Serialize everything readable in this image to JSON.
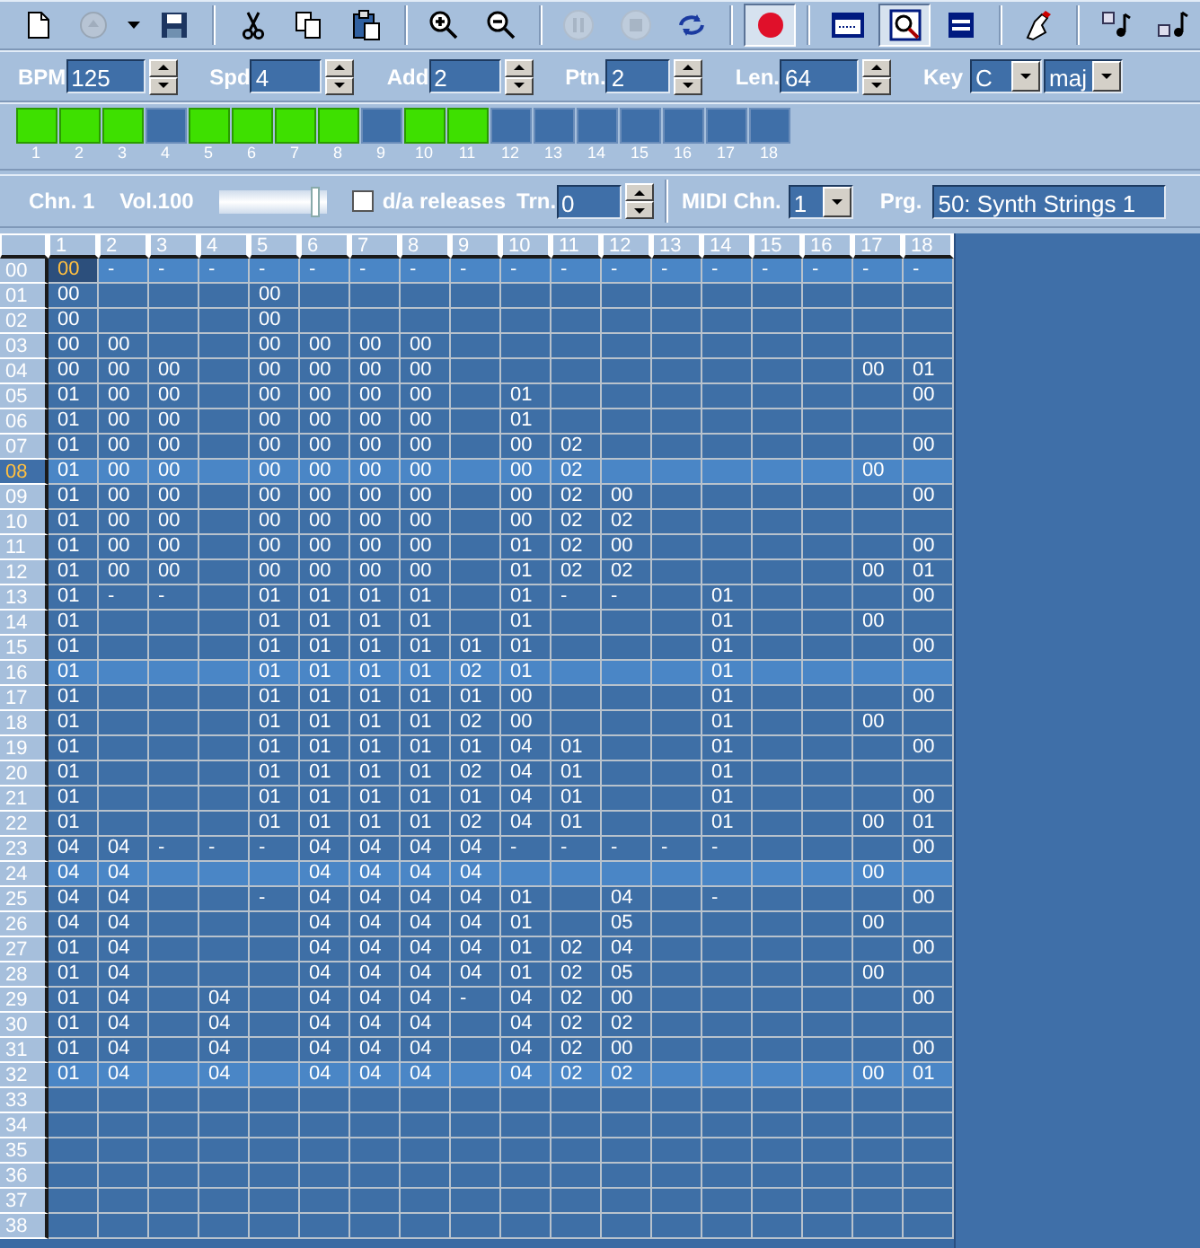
{
  "toolbar": [
    {
      "disabled": false,
      "pressed": false
    },
    {
      "disabled": true,
      "pressed": false
    },
    {
      "disabled": false,
      "pressed": false
    },
    {
      "disabled": false,
      "pressed": false
    },
    {
      "disabled": false,
      "pressed": false
    },
    {
      "disabled": false,
      "pressed": false
    },
    {
      "disabled": false,
      "pressed": false
    },
    {
      "disabled": false,
      "pressed": false
    },
    {
      "disabled": false,
      "pressed": false
    },
    {
      "disabled": true,
      "pressed": false
    },
    {
      "disabled": true,
      "pressed": false
    },
    {
      "disabled": false,
      "pressed": false
    },
    {
      "disabled": false,
      "pressed": true
    },
    {
      "disabled": false,
      "pressed": false
    },
    {
      "disabled": false,
      "pressed": true
    },
    {
      "disabled": false,
      "pressed": false
    },
    {
      "disabled": false,
      "pressed": false
    },
    {
      "disabled": false,
      "pressed": false
    },
    {
      "disabled": false,
      "pressed": false
    }
  ],
  "song": [
    {
      "kind": "spin",
      "label": "BPM",
      "value": "125"
    },
    {
      "kind": "spin",
      "label": "Spd",
      "value": "4"
    },
    {
      "kind": "spin",
      "label": "Add",
      "value": "2"
    },
    {
      "kind": "spin",
      "label": "Ptn.",
      "value": "2"
    },
    {
      "kind": "spin",
      "label": "Len.",
      "value": "64"
    },
    {
      "kind": "combo",
      "label": "Key",
      "value": "C"
    },
    {
      "kind": "combo",
      "value": "maj"
    }
  ],
  "patterns": [
    {
      "label": "1",
      "on": true
    },
    {
      "label": "2",
      "on": true
    },
    {
      "label": "3",
      "on": true
    },
    {
      "label": "4",
      "on": false
    },
    {
      "label": "5",
      "on": true
    },
    {
      "label": "6",
      "on": true
    },
    {
      "label": "7",
      "on": true
    },
    {
      "label": "8",
      "on": true
    },
    {
      "label": "9",
      "on": false
    },
    {
      "label": "10",
      "on": true
    },
    {
      "label": "11",
      "on": true
    },
    {
      "label": "12",
      "on": false
    },
    {
      "label": "13",
      "on": false
    },
    {
      "label": "14",
      "on": false
    },
    {
      "label": "15",
      "on": false
    },
    {
      "label": "16",
      "on": false
    },
    {
      "label": "17",
      "on": false
    },
    {
      "label": "18",
      "on": false
    }
  ],
  "channel": {
    "name": "Chn. 1",
    "volume": "Vol.100",
    "volume_slider": {
      "level": 0.93
    },
    "releases": {
      "label": "d/a releases",
      "checked": false
    },
    "transpose": {
      "label": "Trn.",
      "value": "0"
    },
    "midi_channel": {
      "label": "MIDI Chn.",
      "value": "1"
    },
    "program": {
      "label": "Prg.",
      "value": "50: Synth Strings 1"
    }
  },
  "grid": {
    "columns": [
      "1",
      "2",
      "3",
      "4",
      "5",
      "6",
      "7",
      "8",
      "9",
      "10",
      "11",
      "12",
      "13",
      "14",
      "15",
      "16",
      "17",
      "18"
    ],
    "rows": [
      {
        "label": "00",
        "highlight": true,
        "playing": false,
        "cells": [
          {
            "text": "00",
            "cursor": true
          },
          "-",
          "-",
          "-",
          "-",
          "-",
          "-",
          "-",
          "-",
          "-",
          "-",
          "-",
          "-",
          "-",
          "-",
          "-",
          "-",
          "-"
        ]
      },
      {
        "label": "01",
        "highlight": false,
        "playing": false,
        "cells": [
          "00",
          null,
          null,
          null,
          "00",
          null,
          null,
          null,
          null,
          null,
          null,
          null,
          null,
          null,
          null,
          null,
          null,
          null
        ]
      },
      {
        "label": "02",
        "highlight": false,
        "playing": false,
        "cells": [
          "00",
          null,
          null,
          null,
          "00",
          null,
          null,
          null,
          null,
          null,
          null,
          null,
          null,
          null,
          null,
          null,
          null,
          null
        ]
      },
      {
        "label": "03",
        "highlight": false,
        "playing": false,
        "cells": [
          "00",
          "00",
          null,
          null,
          "00",
          "00",
          "00",
          "00",
          null,
          null,
          null,
          null,
          null,
          null,
          null,
          null,
          null,
          null
        ]
      },
      {
        "label": "04",
        "highlight": false,
        "playing": false,
        "cells": [
          "00",
          "00",
          "00",
          null,
          "00",
          "00",
          "00",
          "00",
          null,
          null,
          null,
          null,
          null,
          null,
          null,
          null,
          "00",
          "01"
        ]
      },
      {
        "label": "05",
        "highlight": false,
        "playing": false,
        "cells": [
          "01",
          "00",
          "00",
          null,
          "00",
          "00",
          "00",
          "00",
          null,
          "01",
          null,
          null,
          null,
          null,
          null,
          null,
          null,
          "00"
        ]
      },
      {
        "label": "06",
        "highlight": false,
        "playing": false,
        "cells": [
          "01",
          "00",
          "00",
          null,
          "00",
          "00",
          "00",
          "00",
          null,
          "01",
          null,
          null,
          null,
          null,
          null,
          null,
          null,
          null
        ]
      },
      {
        "label": "07",
        "highlight": false,
        "playing": false,
        "cells": [
          "01",
          "00",
          "00",
          null,
          "00",
          "00",
          "00",
          "00",
          null,
          "00",
          "02",
          null,
          null,
          null,
          null,
          null,
          null,
          "00"
        ]
      },
      {
        "label": "08",
        "highlight": true,
        "playing": true,
        "cells": [
          "01",
          "00",
          "00",
          null,
          "00",
          "00",
          "00",
          "00",
          null,
          "00",
          "02",
          null,
          null,
          null,
          null,
          null,
          "00",
          null
        ]
      },
      {
        "label": "09",
        "highlight": false,
        "playing": false,
        "cells": [
          "01",
          "00",
          "00",
          null,
          "00",
          "00",
          "00",
          "00",
          null,
          "00",
          "02",
          "00",
          null,
          null,
          null,
          null,
          null,
          "00"
        ]
      },
      {
        "label": "10",
        "highlight": false,
        "playing": false,
        "cells": [
          "01",
          "00",
          "00",
          null,
          "00",
          "00",
          "00",
          "00",
          null,
          "00",
          "02",
          "02",
          null,
          null,
          null,
          null,
          null,
          null
        ]
      },
      {
        "label": "11",
        "highlight": false,
        "playing": false,
        "cells": [
          "01",
          "00",
          "00",
          null,
          "00",
          "00",
          "00",
          "00",
          null,
          "01",
          "02",
          "00",
          null,
          null,
          null,
          null,
          null,
          "00"
        ]
      },
      {
        "label": "12",
        "highlight": false,
        "playing": false,
        "cells": [
          "01",
          "00",
          "00",
          null,
          "00",
          "00",
          "00",
          "00",
          null,
          "01",
          "02",
          "02",
          null,
          null,
          null,
          null,
          "00",
          "01"
        ]
      },
      {
        "label": "13",
        "highlight": false,
        "playing": false,
        "cells": [
          "01",
          "-",
          "-",
          null,
          "01",
          "01",
          "01",
          "01",
          null,
          "01",
          "-",
          "-",
          null,
          "01",
          null,
          null,
          null,
          "00"
        ]
      },
      {
        "label": "14",
        "highlight": false,
        "playing": false,
        "cells": [
          "01",
          null,
          null,
          null,
          "01",
          "01",
          "01",
          "01",
          null,
          "01",
          null,
          null,
          null,
          "01",
          null,
          null,
          "00",
          null
        ]
      },
      {
        "label": "15",
        "highlight": false,
        "playing": false,
        "cells": [
          "01",
          null,
          null,
          null,
          "01",
          "01",
          "01",
          "01",
          "01",
          "01",
          null,
          null,
          null,
          "01",
          null,
          null,
          null,
          "00"
        ]
      },
      {
        "label": "16",
        "highlight": true,
        "playing": false,
        "cells": [
          "01",
          null,
          null,
          null,
          "01",
          "01",
          "01",
          "01",
          "02",
          "01",
          null,
          null,
          null,
          "01",
          null,
          null,
          null,
          null
        ]
      },
      {
        "label": "17",
        "highlight": false,
        "playing": false,
        "cells": [
          "01",
          null,
          null,
          null,
          "01",
          "01",
          "01",
          "01",
          "01",
          "00",
          null,
          null,
          null,
          "01",
          null,
          null,
          null,
          "00"
        ]
      },
      {
        "label": "18",
        "highlight": false,
        "playing": false,
        "cells": [
          "01",
          null,
          null,
          null,
          "01",
          "01",
          "01",
          "01",
          "02",
          "00",
          null,
          null,
          null,
          "01",
          null,
          null,
          "00",
          null
        ]
      },
      {
        "label": "19",
        "highlight": false,
        "playing": false,
        "cells": [
          "01",
          null,
          null,
          null,
          "01",
          "01",
          "01",
          "01",
          "01",
          "04",
          "01",
          null,
          null,
          "01",
          null,
          null,
          null,
          "00"
        ]
      },
      {
        "label": "20",
        "highlight": false,
        "playing": false,
        "cells": [
          "01",
          null,
          null,
          null,
          "01",
          "01",
          "01",
          "01",
          "02",
          "04",
          "01",
          null,
          null,
          "01",
          null,
          null,
          null,
          null
        ]
      },
      {
        "label": "21",
        "highlight": false,
        "playing": false,
        "cells": [
          "01",
          null,
          null,
          null,
          "01",
          "01",
          "01",
          "01",
          "01",
          "04",
          "01",
          null,
          null,
          "01",
          null,
          null,
          null,
          "00"
        ]
      },
      {
        "label": "22",
        "highlight": false,
        "playing": false,
        "cells": [
          "01",
          null,
          null,
          null,
          "01",
          "01",
          "01",
          "01",
          "02",
          "04",
          "01",
          null,
          null,
          "01",
          null,
          null,
          "00",
          "01"
        ]
      },
      {
        "label": "23",
        "highlight": false,
        "playing": false,
        "cells": [
          "04",
          "04",
          "-",
          "-",
          "-",
          "04",
          "04",
          "04",
          "04",
          "-",
          "-",
          "-",
          "-",
          "-",
          null,
          null,
          null,
          "00"
        ]
      },
      {
        "label": "24",
        "highlight": true,
        "playing": false,
        "cells": [
          "04",
          "04",
          null,
          null,
          null,
          "04",
          "04",
          "04",
          "04",
          null,
          null,
          null,
          null,
          null,
          null,
          null,
          "00",
          null
        ]
      },
      {
        "label": "25",
        "highlight": false,
        "playing": false,
        "cells": [
          "04",
          "04",
          null,
          null,
          "-",
          "04",
          "04",
          "04",
          "04",
          "01",
          null,
          "04",
          null,
          "-",
          null,
          null,
          null,
          "00"
        ]
      },
      {
        "label": "26",
        "highlight": false,
        "playing": false,
        "cells": [
          "04",
          "04",
          null,
          null,
          null,
          "04",
          "04",
          "04",
          "04",
          "01",
          null,
          "05",
          null,
          null,
          null,
          null,
          "00",
          null
        ]
      },
      {
        "label": "27",
        "highlight": false,
        "playing": false,
        "cells": [
          "01",
          "04",
          null,
          null,
          null,
          "04",
          "04",
          "04",
          "04",
          "01",
          "02",
          "04",
          null,
          null,
          null,
          null,
          null,
          "00"
        ]
      },
      {
        "label": "28",
        "highlight": false,
        "playing": false,
        "cells": [
          "01",
          "04",
          null,
          null,
          null,
          "04",
          "04",
          "04",
          "04",
          "01",
          "02",
          "05",
          null,
          null,
          null,
          null,
          "00",
          null
        ]
      },
      {
        "label": "29",
        "highlight": false,
        "playing": false,
        "cells": [
          "01",
          "04",
          null,
          "04",
          null,
          "04",
          "04",
          "04",
          "-",
          "04",
          "02",
          "00",
          null,
          null,
          null,
          null,
          null,
          "00"
        ]
      },
      {
        "label": "30",
        "highlight": false,
        "playing": false,
        "cells": [
          "01",
          "04",
          null,
          "04",
          null,
          "04",
          "04",
          "04",
          null,
          "04",
          "02",
          "02",
          null,
          null,
          null,
          null,
          null,
          null
        ]
      },
      {
        "label": "31",
        "highlight": false,
        "playing": false,
        "cells": [
          "01",
          "04",
          null,
          "04",
          null,
          "04",
          "04",
          "04",
          null,
          "04",
          "02",
          "00",
          null,
          null,
          null,
          null,
          null,
          "00"
        ]
      },
      {
        "label": "32",
        "highlight": true,
        "playing": false,
        "cells": [
          "01",
          "04",
          null,
          "04",
          null,
          "04",
          "04",
          "04",
          null,
          "04",
          "02",
          "02",
          null,
          null,
          null,
          null,
          "00",
          "01"
        ]
      },
      {
        "label": "33",
        "highlight": false,
        "playing": false,
        "cells": [
          null,
          null,
          null,
          null,
          null,
          null,
          null,
          null,
          null,
          null,
          null,
          null,
          null,
          null,
          null,
          null,
          null,
          null
        ]
      },
      {
        "label": "34",
        "highlight": false,
        "playing": false,
        "cells": [
          null,
          null,
          null,
          null,
          null,
          null,
          null,
          null,
          null,
          null,
          null,
          null,
          null,
          null,
          null,
          null,
          null,
          null
        ]
      },
      {
        "label": "35",
        "highlight": false,
        "playing": false,
        "cells": [
          null,
          null,
          null,
          null,
          null,
          null,
          null,
          null,
          null,
          null,
          null,
          null,
          null,
          null,
          null,
          null,
          null,
          null
        ]
      },
      {
        "label": "36",
        "highlight": false,
        "playing": false,
        "cells": [
          null,
          null,
          null,
          null,
          null,
          null,
          null,
          null,
          null,
          null,
          null,
          null,
          null,
          null,
          null,
          null,
          null,
          null
        ]
      },
      {
        "label": "37",
        "highlight": false,
        "playing": false,
        "cells": [
          null,
          null,
          null,
          null,
          null,
          null,
          null,
          null,
          null,
          null,
          null,
          null,
          null,
          null,
          null,
          null,
          null,
          null
        ]
      },
      {
        "label": "38",
        "highlight": false,
        "playing": false,
        "cells": [
          null,
          null,
          null,
          null,
          null,
          null,
          null,
          null,
          null,
          null,
          null,
          null,
          null,
          null,
          null,
          null,
          null,
          null
        ]
      }
    ]
  }
}
